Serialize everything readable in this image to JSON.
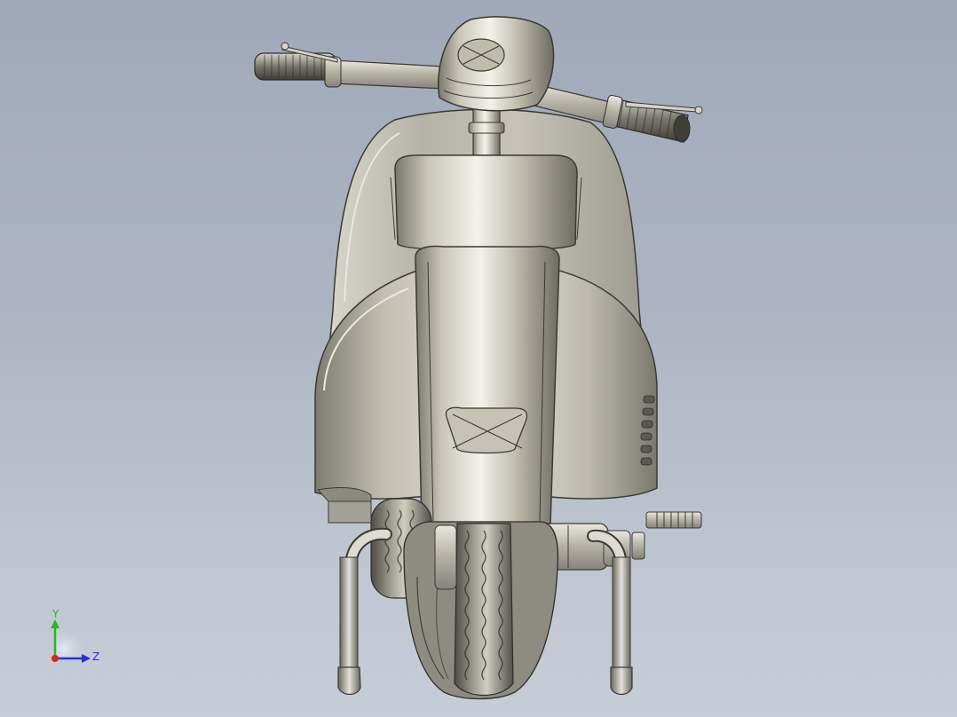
{
  "viewport": {
    "background_top": "#9fa9b9",
    "background_bottom": "#c7cdd7"
  },
  "model": {
    "name": "scooter-front-view",
    "body_color": "#b8b5a6",
    "shadow_color": "#5f5d52",
    "tire_color": "#6b695e"
  },
  "triad": {
    "y_label": "Y",
    "z_label": "Z",
    "y_color": "#22bb22",
    "z_color": "#2233dd",
    "x_color": "#dd2222"
  }
}
